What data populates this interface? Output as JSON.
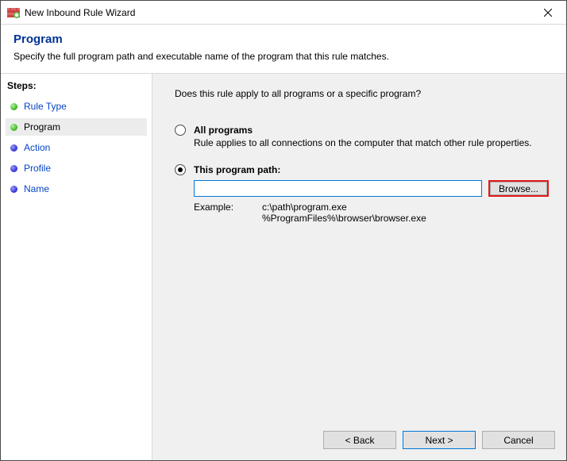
{
  "window": {
    "title": "New Inbound Rule Wizard"
  },
  "header": {
    "title": "Program",
    "subtitle": "Specify the full program path and executable name of the program that this rule matches."
  },
  "sidebar": {
    "heading": "Steps:",
    "items": [
      {
        "label": "Rule Type",
        "state": "done"
      },
      {
        "label": "Program",
        "state": "current"
      },
      {
        "label": "Action",
        "state": "pending"
      },
      {
        "label": "Profile",
        "state": "pending"
      },
      {
        "label": "Name",
        "state": "pending"
      }
    ]
  },
  "content": {
    "question": "Does this rule apply to all programs or a specific program?",
    "options": {
      "all_programs": {
        "label": "All programs",
        "description": "Rule applies to all connections on the computer that match other rule properties.",
        "selected": false
      },
      "this_program": {
        "label": "This program path:",
        "selected": true,
        "path_value": "",
        "browse_label": "Browse...",
        "example_label": "Example:",
        "example_lines": "c:\\path\\program.exe\n%ProgramFiles%\\browser\\browser.exe"
      }
    }
  },
  "footer": {
    "back": "< Back",
    "next": "Next >",
    "cancel": "Cancel"
  }
}
